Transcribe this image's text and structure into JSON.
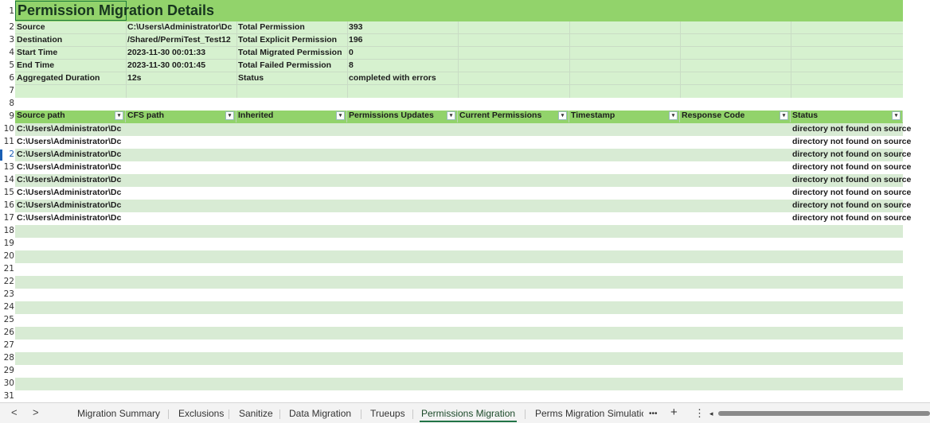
{
  "title": "Permission Migration Details",
  "summary": {
    "rows": [
      {
        "label": "Source",
        "value": "C:\\Users\\Administrator\\Dc",
        "label2": "Total Permission",
        "value2": "393"
      },
      {
        "label": "Destination",
        "value": "/Shared/PermiTest_Test12",
        "label2": "Total Explicit Permission",
        "value2": "196"
      },
      {
        "label": "Start Time",
        "value": "2023-11-30 00:01:33",
        "label2": "Total Migrated Permission",
        "value2": "0"
      },
      {
        "label": "End Time",
        "value": "2023-11-30 00:01:45",
        "label2": "Total Failed Permission",
        "value2": "8"
      },
      {
        "label": "Aggregated Duration",
        "value": "12s",
        "label2": "Status",
        "value2": "completed with errors"
      }
    ]
  },
  "table": {
    "headers": [
      "Source path",
      "CFS path",
      "Inherited",
      "Permissions Updates",
      "Current Permissions",
      "Timestamp",
      "Response Code",
      "Status"
    ],
    "rows": [
      {
        "source": "C:\\Users\\Administrator\\Dc",
        "status": "directory not found on source"
      },
      {
        "source": "C:\\Users\\Administrator\\Dc",
        "status": "directory not found on source"
      },
      {
        "source": "C:\\Users\\Administrator\\Dc",
        "status": "directory not found on source"
      },
      {
        "source": "C:\\Users\\Administrator\\Dc",
        "status": "directory not found on source"
      },
      {
        "source": "C:\\Users\\Administrator\\Dc",
        "status": "directory not found on source"
      },
      {
        "source": "C:\\Users\\Administrator\\Dc",
        "status": "directory not found on source"
      },
      {
        "source": "C:\\Users\\Administrator\\Dc",
        "status": "directory not found on source"
      },
      {
        "source": "C:\\Users\\Administrator\\Dc",
        "status": "directory not found on source"
      }
    ]
  },
  "row_numbers": [
    "1",
    "2",
    "3",
    "4",
    "5",
    "6",
    "7",
    "8",
    "9",
    "10",
    "11",
    "2",
    "13",
    "14",
    "15",
    "16",
    "17",
    "18",
    "19",
    "20",
    "21",
    "22",
    "23",
    "24",
    "25",
    "26",
    "27",
    "28",
    "29",
    "30",
    "31"
  ],
  "tabs": [
    {
      "label": "Migration Summary"
    },
    {
      "label": "Exclusions"
    },
    {
      "label": "Sanitize"
    },
    {
      "label": "Data Migration"
    },
    {
      "label": "Trueups"
    },
    {
      "label": "Permissions Migration",
      "active": true
    },
    {
      "label": "Perms Migration Simulatic"
    }
  ],
  "tabbar": {
    "prev": "<",
    "next": ">",
    "more": "•••",
    "add": "+",
    "options": "⋮",
    "scroll_left": "◂"
  },
  "colors": {
    "header_green": "#92d36b",
    "band_dark": "#d8ebd4",
    "band_light": "#ffffff",
    "summary_bg": "#d6f1cf",
    "accent": "#217346"
  }
}
